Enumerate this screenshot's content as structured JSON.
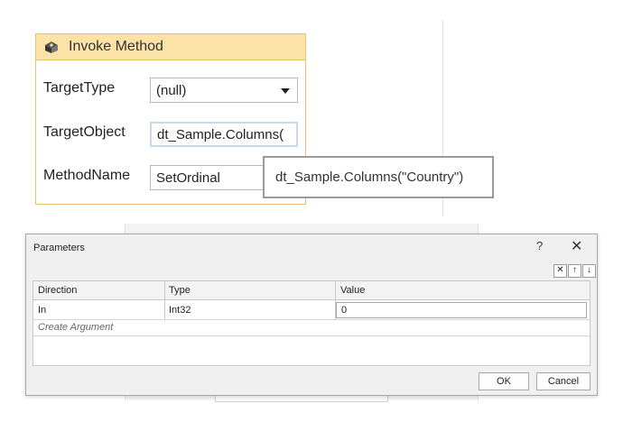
{
  "activity": {
    "title": "Invoke Method",
    "icon": "invoke-method-icon",
    "fields": {
      "target_type": {
        "label": "TargetType",
        "value": "(null)"
      },
      "target_object": {
        "label": "TargetObject",
        "value": "dt_Sample.Columns("
      },
      "method_name": {
        "label": "MethodName",
        "value": "SetOrdinal"
      }
    }
  },
  "tooltip": {
    "text": "dt_Sample.Columns(\"Country\")"
  },
  "dialog": {
    "title": "Parameters",
    "help_label": "?",
    "close_label": "✕",
    "toolbar": {
      "delete_label": "✕",
      "up_label": "↑",
      "down_label": "↓"
    },
    "columns": [
      "Direction",
      "Type",
      "Value"
    ],
    "rows": [
      {
        "direction": "In",
        "type": "Int32",
        "value": "0"
      }
    ],
    "create_argument": "Create Argument",
    "ok_label": "OK",
    "cancel_label": "Cancel"
  }
}
